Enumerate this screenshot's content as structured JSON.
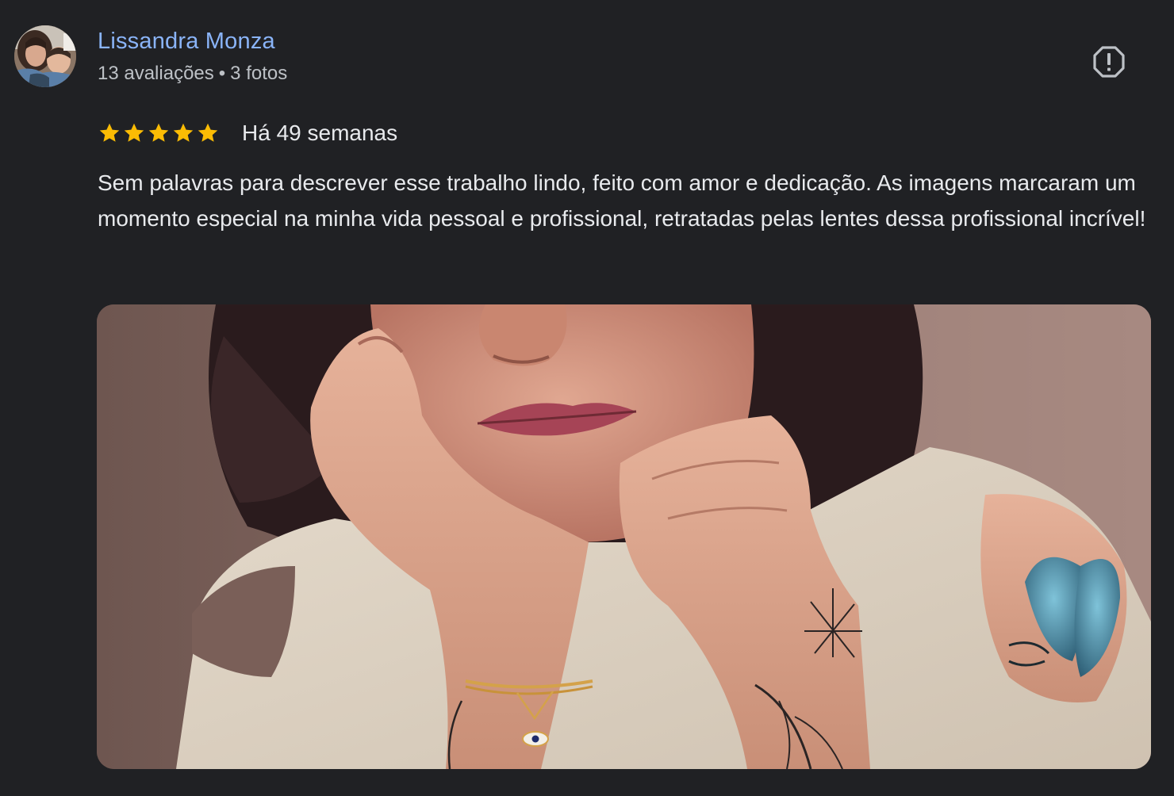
{
  "reviewer": {
    "name": "Lissandra Monza",
    "reviews_count": "13 avaliações",
    "separator": "•",
    "photos_count": "3 fotos"
  },
  "review": {
    "rating": 5,
    "max_rating": 5,
    "date": "Há 49 semanas",
    "text": "Sem palavras para descrever esse trabalho lindo, feito com amor e dedicação. As imagens marcaram um momento especial na minha vida pessoal e profissional, retratadas pelas lentes dessa profissional incrível!"
  },
  "icons": {
    "report": "report-flag-icon",
    "star": "star-icon"
  },
  "colors": {
    "background": "#202124",
    "name_link": "#8ab4f8",
    "star": "#fbbc04",
    "text_primary": "#e8eaed",
    "text_secondary": "#bdc1c6"
  }
}
